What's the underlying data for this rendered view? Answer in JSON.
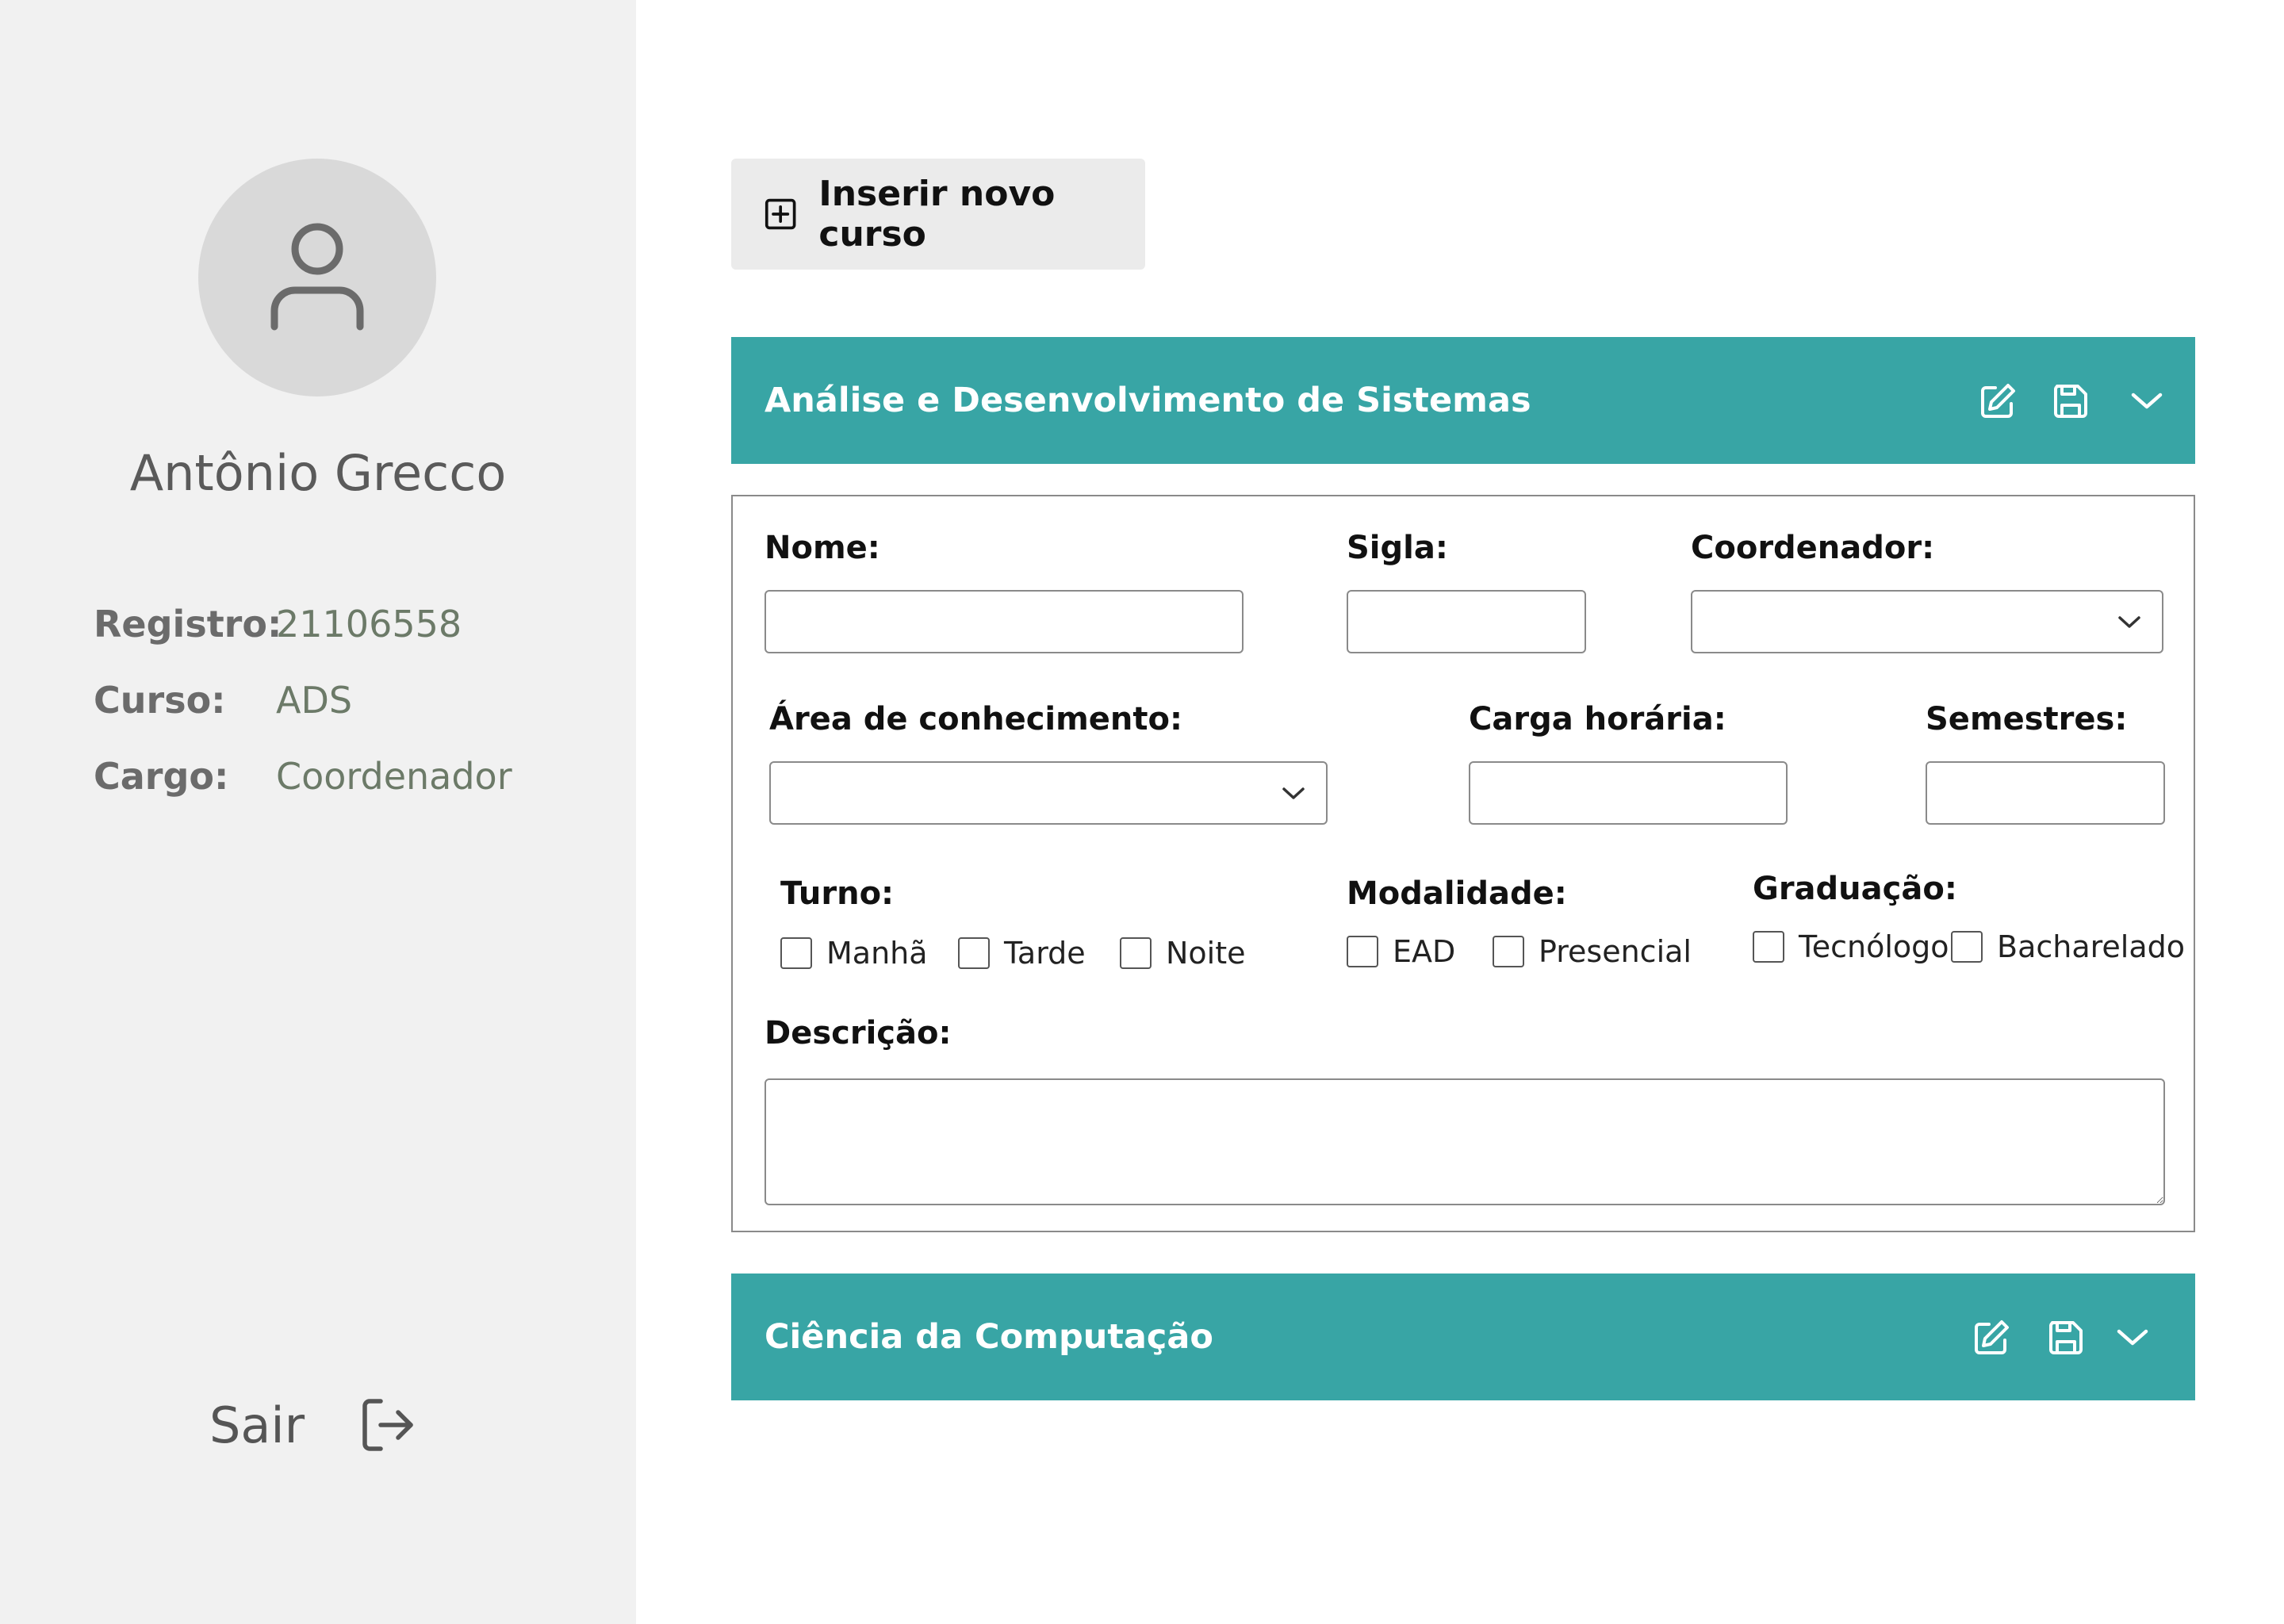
{
  "user": {
    "name": "Antônio Grecco",
    "info": [
      {
        "label": "Registro:",
        "value": "21106558"
      },
      {
        "label": "Curso:",
        "value": "ADS"
      },
      {
        "label": "Cargo:",
        "value": "Coordenador"
      }
    ],
    "logout_label": "Sair"
  },
  "actions": {
    "insert_course_label": "Inserir novo curso"
  },
  "courses": [
    {
      "title": "Análise e Desenvolvimento de Sistemas",
      "expanded": true
    },
    {
      "title": "Ciência da Computação",
      "expanded": false
    }
  ],
  "form": {
    "nome_label": "Nome:",
    "nome_value": "",
    "sigla_label": "Sigla:",
    "sigla_value": "",
    "coordenador_label": "Coordenador:",
    "coordenador_value": "",
    "area_label": "Área de conhecimento:",
    "area_value": "",
    "carga_label": "Carga horária:",
    "carga_value": "",
    "semestres_label": "Semestres:",
    "semestres_value": "",
    "turno_label": "Turno:",
    "turno_options": [
      "Manhã",
      "Tarde",
      "Noite"
    ],
    "modalidade_label": "Modalidade:",
    "modalidade_options": [
      "EAD",
      "Presencial"
    ],
    "graduacao_label": "Graduação:",
    "graduacao_options": [
      "Tecnólogo",
      "Bacharelado"
    ],
    "descricao_label": "Descrição:",
    "descricao_value": ""
  },
  "colors": {
    "accent": "#38a5a5",
    "sidebar_bg": "#f1f1f1",
    "avatar_bg": "#d9d9d9",
    "button_bg": "#ebebeb"
  },
  "icons": {
    "avatar": "user-icon",
    "logout": "logout-icon",
    "insert": "plus-square-icon",
    "edit": "edit-icon",
    "save": "save-icon",
    "expand": "chevron-down-icon"
  }
}
